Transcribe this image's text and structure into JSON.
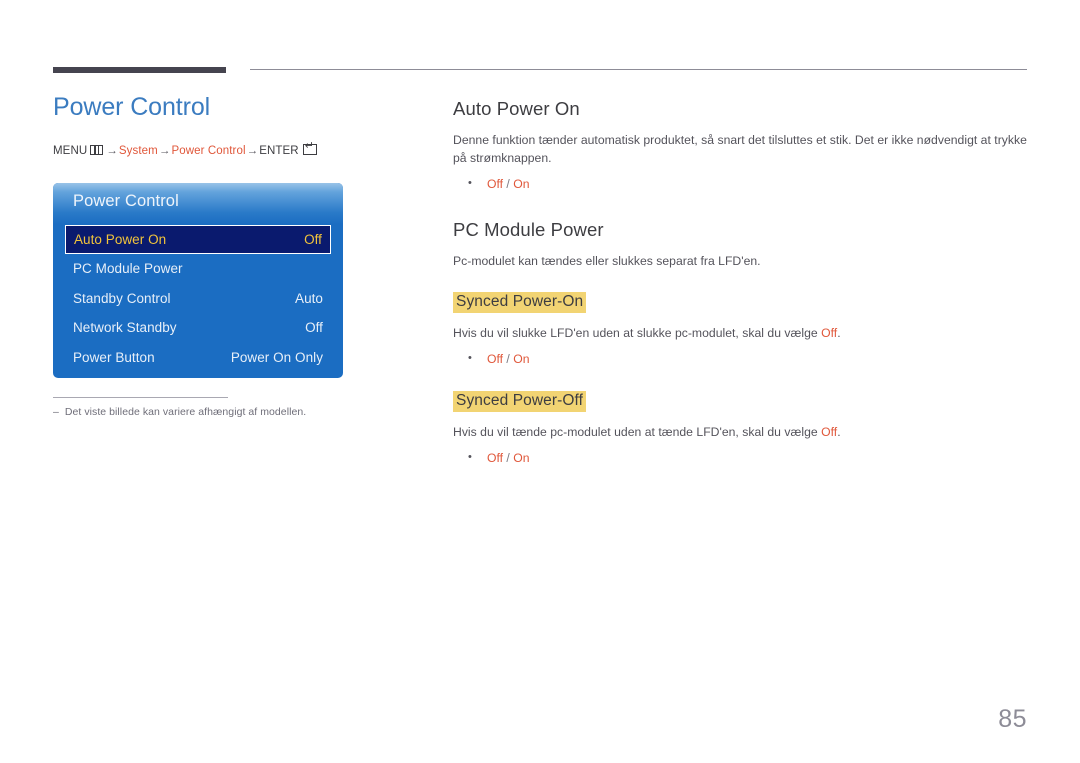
{
  "colors": {
    "accent_orange": "#e0573a",
    "title_blue": "#3b7cc0",
    "osd_blue": "#1b6dc2",
    "osd_selected_bg": "#0a1a6e",
    "osd_selected_text": "#f2c43b",
    "highlight_yellow": "#f2d473",
    "rule_dark": "#45444f",
    "body_gray": "#54535b",
    "page_num_gray": "#8d8c97"
  },
  "left": {
    "title": "Power Control",
    "breadcrumb": {
      "menu_label": "MENU",
      "menu_icon": "menu-bars-icon",
      "arrow": "→",
      "step1": "System",
      "step2": "Power Control",
      "enter_label": "ENTER",
      "enter_icon": "enter-return-icon"
    },
    "osd": {
      "title": "Power Control",
      "rows": [
        {
          "label": "Auto Power On",
          "value": "Off",
          "selected": true
        },
        {
          "label": "PC Module Power",
          "value": "",
          "selected": false
        },
        {
          "label": "Standby Control",
          "value": "Auto",
          "selected": false
        },
        {
          "label": "Network Standby",
          "value": "Off",
          "selected": false
        },
        {
          "label": "Power Button",
          "value": "Power On Only",
          "selected": false
        }
      ]
    },
    "footnote": {
      "dash": "–",
      "text": "Det viste billede kan variere afhængigt af modellen."
    }
  },
  "right": {
    "section1": {
      "heading": "Auto Power On",
      "body": "Denne funktion tænder automatisk produktet, så snart det tilsluttes et stik. Det er ikke nødvendigt at trykke på strømknappen.",
      "options": {
        "off": "Off",
        "slash": " / ",
        "on": "On"
      }
    },
    "section2": {
      "heading": "PC Module Power",
      "body": "Pc-modulet kan tændes eller slukkes separat fra LFD'en.",
      "sub1": {
        "heading": "Synced Power-On",
        "body_before": "Hvis du vil slukke LFD'en uden at slukke pc-modulet, skal du vælge ",
        "body_accent": "Off",
        "body_after": ".",
        "options": {
          "off": "Off",
          "slash": " / ",
          "on": "On"
        }
      },
      "sub2": {
        "heading": "Synced Power-Off",
        "body_before": "Hvis du vil tænde pc-modulet uden at tænde LFD'en, skal du vælge ",
        "body_accent": "Off",
        "body_after": ".",
        "options": {
          "off": "Off",
          "slash": " / ",
          "on": "On"
        }
      }
    }
  },
  "footer": {
    "page_number": "85"
  }
}
